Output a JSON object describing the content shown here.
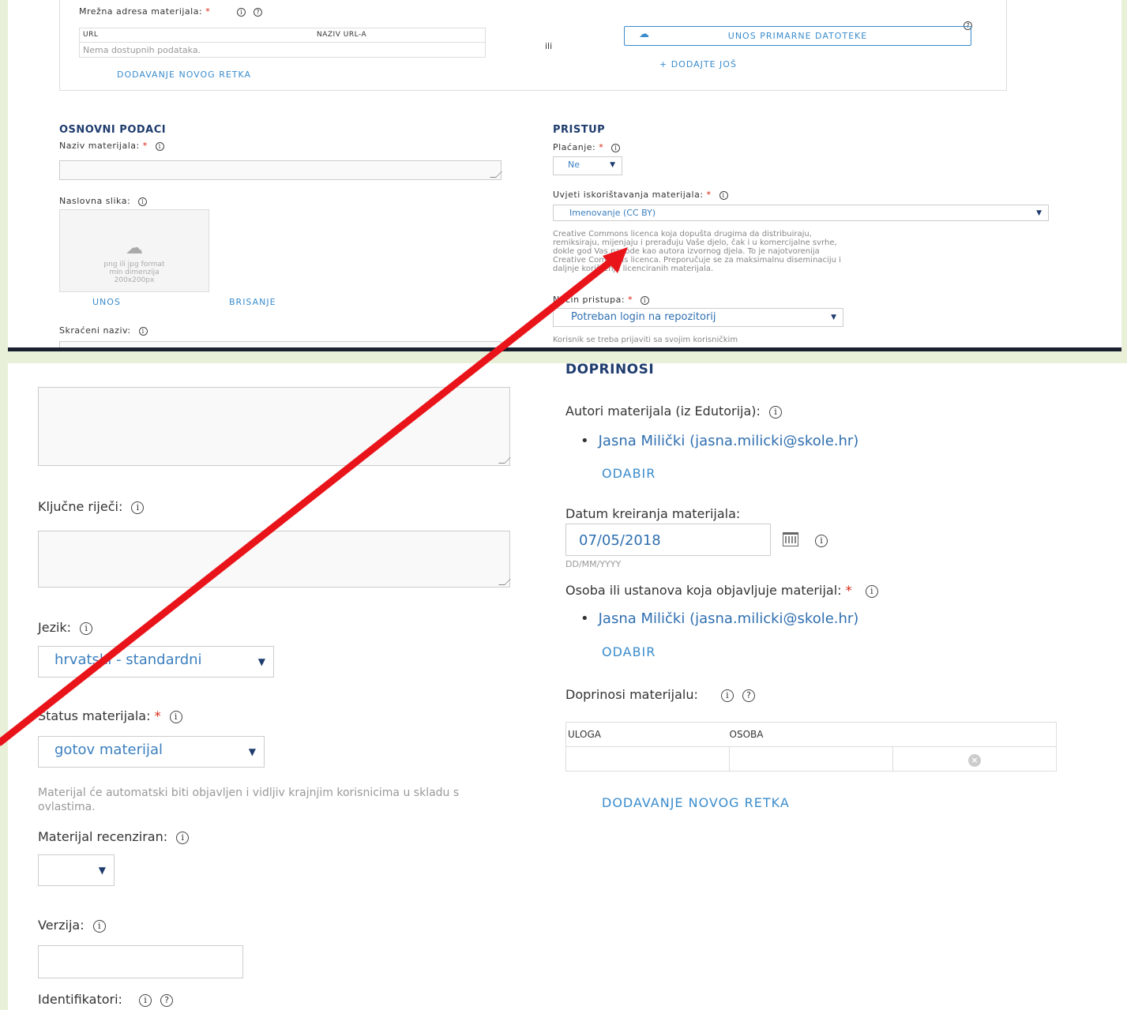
{
  "top": {
    "url_section": {
      "label": "Mrežna adresa materijala:",
      "required_mark": "*",
      "col_url": "URL",
      "col_name": "NAZIV URL-A",
      "empty_text": "Nema dostupnih podataka.",
      "add_row": "DODAVANJE NOVOG RETKA",
      "or_text": "ili",
      "upload_button": "UNOS PRIMARNE DATOTEKE",
      "add_more": "+ DODAJTE JOŠ"
    },
    "basic": {
      "title": "OSNOVNI PODACI",
      "name_label": "Naziv materijala:",
      "cover_label": "Naslovna slika:",
      "cover_hint_1": "png ili jpg format",
      "cover_hint_2": "min dimenzija",
      "cover_hint_3": "200x200px",
      "upload": "UNOS",
      "delete": "BRISANJE",
      "short_name_label": "Skraćeni naziv:"
    },
    "access": {
      "title": "PRISTUP",
      "payment_label": "Plaćanje:",
      "payment_value": "Ne",
      "terms_label": "Uvjeti iskorištavanja materijala:",
      "terms_value": "Imenovanje (CC BY)",
      "terms_desc": "Creative Commons licenca koja dopušta drugima da distribuiraju, remiksiraju, mijenjaju i prerađuju Vaše djelo, čak i u komercijalne svrhe, dokle god Vas navode kao autora izvornog djela. To je najotvorenija Creative Commons licenca. Preporučuje se za maksimalnu diseminaciju i daljnje korištenje licenciranih materijala.",
      "access_label": "Način pristupa:",
      "access_value": "Potreban login na repozitorij",
      "access_desc": "Korisnik se treba prijaviti sa svojim korisničkim"
    }
  },
  "bottom": {
    "keywords_label": "Ključne riječi:",
    "language_label": "Jezik:",
    "language_value": "hrvatski - standardni",
    "status_label": "Status materijala:",
    "status_value": "gotov materijal",
    "status_desc": "Materijal će automatski biti objavljen i vidljiv krajnjim korisnicima u skladu s ovlastima.",
    "reviewed_label": "Materijal recenziran:",
    "version_label": "Verzija:",
    "identifiers_label": "Identifikatori:",
    "contrib_title": "DOPRINOSI",
    "authors_label": "Autori materijala (iz Edutorija):",
    "author_1": "Jasna Milički (jasna.milicki@skole.hr)",
    "choose_1": "ODABIR",
    "date_label": "Datum kreiranja materijala:",
    "date_value": "07/05/2018",
    "date_format": "DD/MM/YYYY",
    "publisher_label": "Osoba ili ustanova koja objavljuje materijal:",
    "publisher_1": "Jasna Milički (jasna.milicki@skole.hr)",
    "choose_2": "ODABIR",
    "contrib_label": "Doprinosi materijalu:",
    "col_role": "ULOGA",
    "col_person": "OSOBA",
    "add_row": "DODAVANJE NOVOG RETKA",
    "required_mark": "*"
  },
  "colors": {
    "accent": "#3a8ccc",
    "title": "#1f3c6e",
    "required": "#d9230f",
    "arrow": "#e8141a",
    "page_bg": "#e8f0d8"
  }
}
